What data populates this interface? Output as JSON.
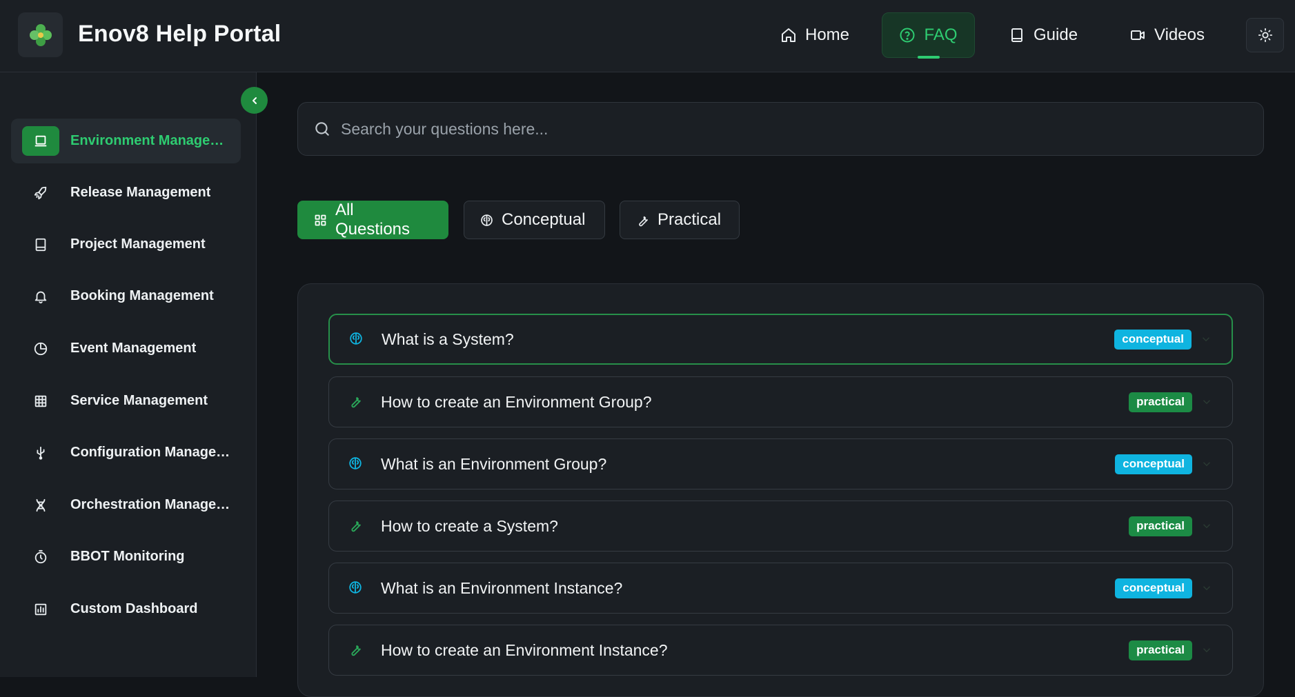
{
  "header": {
    "title": "Enov8 Help Portal",
    "nav": [
      {
        "label": "Home",
        "icon": "home-icon"
      },
      {
        "label": "FAQ",
        "icon": "help-circle-icon",
        "active": true
      },
      {
        "label": "Guide",
        "icon": "book-icon"
      },
      {
        "label": "Videos",
        "icon": "video-icon"
      }
    ],
    "theme_toggle_icon": "sun-icon"
  },
  "sidebar": {
    "collapse_icon": "chevron-left-icon",
    "items": [
      {
        "label": "Environment Management",
        "icon": "laptop-icon",
        "active": true
      },
      {
        "label": "Release Management",
        "icon": "rocket-icon"
      },
      {
        "label": "Project Management",
        "icon": "book-icon"
      },
      {
        "label": "Booking Management",
        "icon": "bell-icon"
      },
      {
        "label": "Event Management",
        "icon": "pie-chart-icon"
      },
      {
        "label": "Service Management",
        "icon": "grid-icon"
      },
      {
        "label": "Configuration Management",
        "icon": "usb-icon"
      },
      {
        "label": "Orchestration Management",
        "icon": "dna-icon"
      },
      {
        "label": "BBOT Monitoring",
        "icon": "timer-icon"
      },
      {
        "label": "Custom Dashboard",
        "icon": "bar-chart-icon"
      }
    ]
  },
  "search": {
    "placeholder": "Search your questions here...",
    "value": ""
  },
  "filters": [
    {
      "label": "All Questions",
      "icon": "grid-icon",
      "active": true
    },
    {
      "label": "Conceptual",
      "icon": "brain-icon"
    },
    {
      "label": "Practical",
      "icon": "wrench-icon"
    }
  ],
  "questions": [
    {
      "text": "What is a System?",
      "type": "conceptual",
      "badge": "conceptual"
    },
    {
      "text": "How to create an Environment Group?",
      "type": "practical",
      "badge": "practical"
    },
    {
      "text": "What is an Environment Group?",
      "type": "conceptual",
      "badge": "conceptual"
    },
    {
      "text": "How to create a System?",
      "type": "practical",
      "badge": "practical"
    },
    {
      "text": "What is an Environment Instance?",
      "type": "conceptual",
      "badge": "conceptual"
    },
    {
      "text": "How to create an Environment Instance?",
      "type": "practical",
      "badge": "practical"
    }
  ],
  "colors": {
    "accent": "#2ecc71",
    "accent_dark": "#1f8a3e",
    "conceptual": "#0fb4e0",
    "practical": "#1c8b45",
    "background": "#121519",
    "surface": "#1b1f24"
  }
}
